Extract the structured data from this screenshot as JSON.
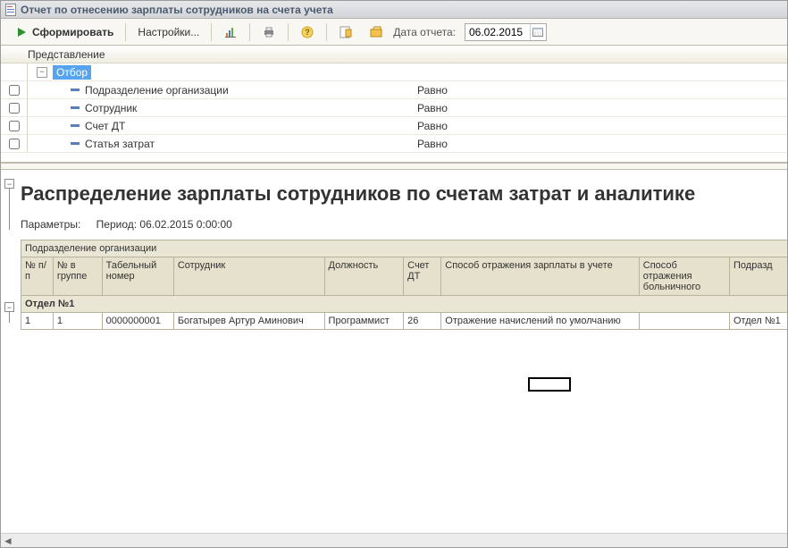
{
  "window": {
    "title": "Отчет по отнесению зарплаты сотрудников на счета учета"
  },
  "toolbar": {
    "form": "Сформировать",
    "settings": "Настройки...",
    "date_label": "Дата отчета:",
    "date_value": "06.02.2015"
  },
  "filter": {
    "header": "Представление",
    "root": "Отбор",
    "items": [
      {
        "label": "Подразделение организации",
        "cond": "Равно"
      },
      {
        "label": "Сотрудник",
        "cond": "Равно"
      },
      {
        "label": "Счет ДТ",
        "cond": "Равно"
      },
      {
        "label": "Статья затрат",
        "cond": "Равно"
      }
    ]
  },
  "report": {
    "title": "Распределение зарплаты сотрудников по счетам затрат и аналитике",
    "params_label": "Параметры:",
    "period": "Период: 06.02.2015 0:00:00",
    "superheader": "Подразделение организации",
    "columns": {
      "npp": "№ п/п",
      "ngrp": "№ в группе",
      "tab": "Табельный номер",
      "emp": "Сотрудник",
      "pos": "Должность",
      "acc": "Счет ДТ",
      "method": "Способ отражения зарплаты в учете",
      "sick": "Способ отражения больничного",
      "dept": "Подразд"
    },
    "group": "Отдел №1",
    "rows": [
      {
        "npp": "1",
        "ngrp": "1",
        "tab": "0000000001",
        "emp": "Богатырев Артур Аминович",
        "pos": "Программист",
        "acc": "26",
        "method": "Отражение начислений по умолчанию",
        "sick": "",
        "dept": "Отдел №1"
      }
    ]
  }
}
